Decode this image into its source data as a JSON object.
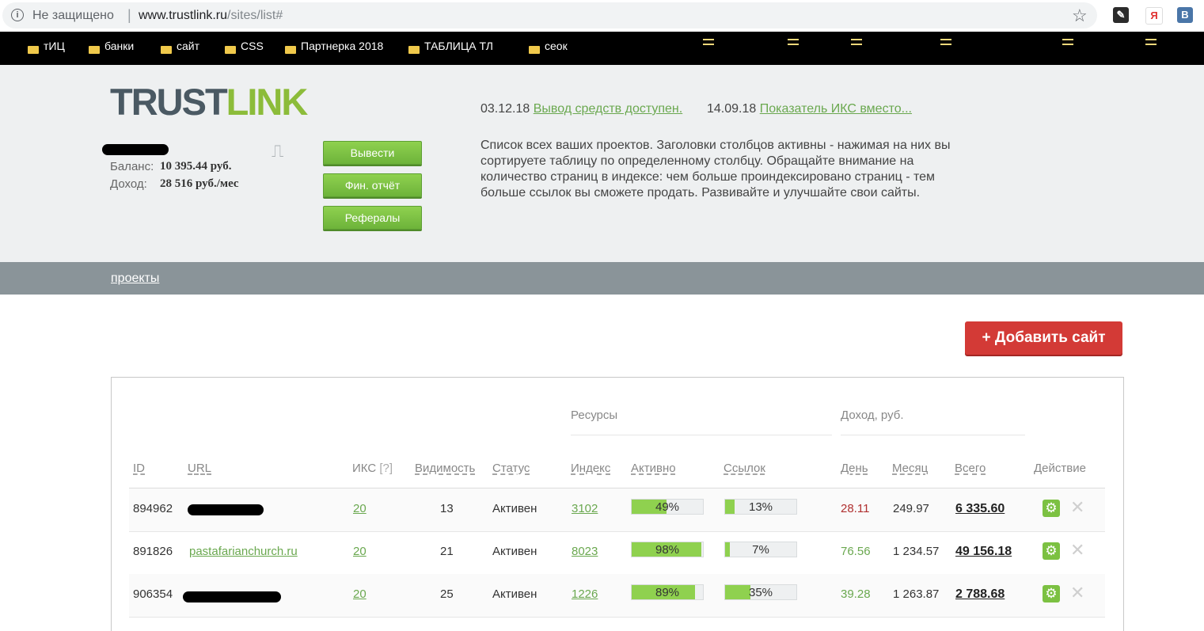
{
  "browser": {
    "security_label": "Не защищено",
    "url_host": "www.trustlink.ru",
    "url_path": "/sites/list#",
    "bookmarks": [
      "тИЦ",
      "банки",
      "сайт",
      "CSS",
      "Партнерка 2018",
      "ТАБЛИЦА ТЛ",
      "сеок"
    ]
  },
  "brand": {
    "logo_part1": "TRUST",
    "logo_part2": "LINK",
    "colors": {
      "dark": "#4a5963",
      "green": "#8cbc3a"
    }
  },
  "account": {
    "balance_label": "Баланс:",
    "balance_value": "10 395.44  руб.",
    "income_label": "Доход:",
    "income_value": "28 516 руб./мес"
  },
  "actions": {
    "withdraw": "Вывести",
    "fin_report": "Фин. отчёт",
    "referrals": "Рефералы"
  },
  "news": [
    {
      "date": "03.12.18",
      "text": "Вывод средств доступен."
    },
    {
      "date": "14.09.18",
      "text": "Показатель ИКС вместо..."
    }
  ],
  "description": "Список всех ваших проектов. Заголовки столбцов активны - нажимая на них вы сортируете таблицу по определенному столбцу. Обращайте внимание на количество страниц в индексе: чем больше проиндексировано страниц - тем больше ссылок вы сможете продать. Развивайте и улучшайте свои сайты.",
  "nav": {
    "projects": "проекты"
  },
  "add_site_button": "+ Добавить сайт",
  "table": {
    "group_resources": "Ресурсы",
    "group_income": "Доход,  руб.",
    "columns": {
      "id": "ID",
      "url": "URL",
      "iks": "ИКС",
      "iks_help": "[?]",
      "visibility": "Видимость",
      "status": "Статус",
      "index": "Индекс",
      "active": "Активно",
      "links": "Ссылок",
      "day": "День",
      "month": "Месяц",
      "total": "Всего",
      "action": "Действие"
    },
    "rows": [
      {
        "id": "894962",
        "url": "",
        "iks": "20",
        "visibility": "13",
        "status": "Активен",
        "index": "3102",
        "active_pct": 49,
        "active_label": "49%",
        "links_pct": 13,
        "links_label": "13%",
        "day": "28.11",
        "month": "249.97",
        "total": "6 335.60"
      },
      {
        "id": "891826",
        "url": "pastafarianchurch.ru",
        "iks": "20",
        "visibility": "21",
        "status": "Активен",
        "index": "8023",
        "active_pct": 98,
        "active_label": "98%",
        "links_pct": 7,
        "links_label": "7%",
        "day": "76.56",
        "month": "1 234.57",
        "total": "49 156.18"
      },
      {
        "id": "906354",
        "url": "",
        "iks": "20",
        "visibility": "25",
        "status": "Активен",
        "index": "1226",
        "active_pct": 89,
        "active_label": "89%",
        "links_pct": 35,
        "links_label": "35%",
        "day": "39.28",
        "month": "1 263.87",
        "total": "2 788.68"
      }
    ]
  }
}
